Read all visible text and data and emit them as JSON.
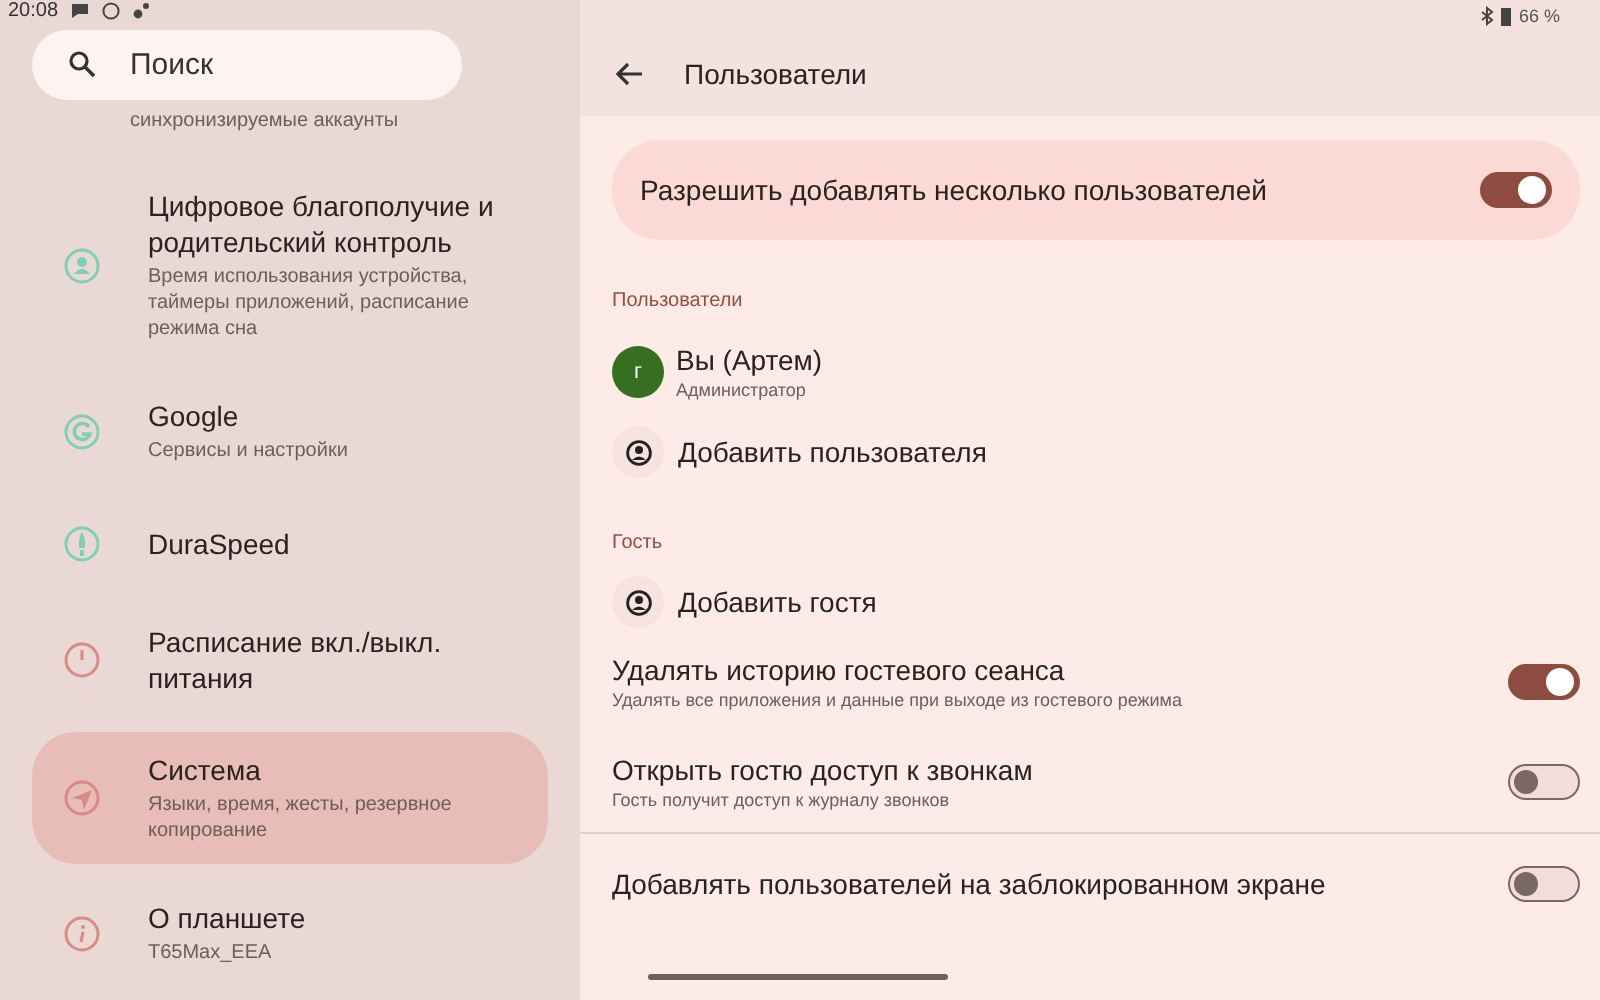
{
  "status_bar": {
    "time": "20:08",
    "battery": "66 %"
  },
  "search": {
    "placeholder": "Поиск"
  },
  "sidebar": {
    "partial_subtitle": "синхронизируемые аккаунты",
    "items": [
      {
        "title": "Цифровое благополучие и родительский контроль",
        "subtitle": "Время использования устройства, таймеры приложений, расписание режима сна",
        "selected": false
      },
      {
        "title": "Google",
        "subtitle": "Сервисы и настройки",
        "selected": false
      },
      {
        "title": "DuraSpeed",
        "selected": false
      },
      {
        "title": "Расписание вкл./выкл. питания",
        "selected": false
      },
      {
        "title": "Система",
        "subtitle": "Языки, время, жесты, резервное копирование",
        "selected": true
      },
      {
        "title": "О планшете",
        "subtitle": "T65Max_EEA",
        "selected": false
      }
    ]
  },
  "page": {
    "title": "Пользователи",
    "main_switch": {
      "label": "Разрешить добавлять несколько пользователей",
      "on": true
    },
    "users_header": "Пользователи",
    "user": {
      "initial": "г",
      "name": "Вы (Артем)",
      "role": "Администратор"
    },
    "add_user": "Добавить пользователя",
    "guest_header": "Гость",
    "add_guest": "Добавить гостя",
    "settings": [
      {
        "title": "Удалять историю гостевого сеанса",
        "subtitle": "Удалять все приложения и данные при выходе из гостевого режима",
        "on": true
      },
      {
        "title": "Открыть гостю доступ к звонкам",
        "subtitle": "Гость получит доступ к журналу звонков",
        "on": false
      },
      {
        "title": "Добавлять пользователей на заблокированном экране",
        "on": false
      }
    ]
  }
}
